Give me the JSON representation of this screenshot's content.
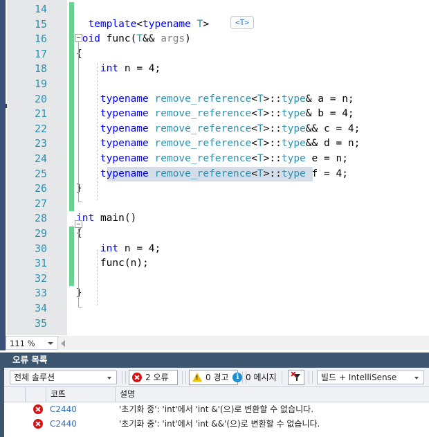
{
  "editor": {
    "zoom_level": "111 %",
    "first_line": 14,
    "lines": [
      {
        "n": 14,
        "html": "",
        "changed": true
      },
      {
        "n": 15,
        "html": "  <span class='kw'>template</span><span class='punc'>&lt;</span><span class='kw'>typename</span> <span class='typ'>T</span><span class='punc'>&gt;</span>",
        "changed": true
      },
      {
        "n": 16,
        "html": "<span class='kw'>void</span> <span class='ident'>func</span><span class='punc'>(</span><span class='typ'>T</span><span class='punc'>&amp;&amp;</span> <span class='gray'>args</span><span class='punc'>)</span>",
        "changed": true
      },
      {
        "n": 17,
        "html": "<span class='punc'>{</span>",
        "changed": true
      },
      {
        "n": 18,
        "html": "    <span class='kw'>int</span> <span class='ident'>n</span> = <span class='ident'>4</span>;",
        "changed": true
      },
      {
        "n": 19,
        "html": "",
        "changed": true
      },
      {
        "n": 20,
        "html": "    <span class='kw'>typename</span> <span class='typ'>remove_reference</span><span class='punc'>&lt;</span><span class='typ'>T</span><span class='punc'>&gt;::</span><span class='typ'>type</span><span class='punc'>&amp;</span> <span class='ident'>a</span> = <span class='ident'>n</span>;",
        "changed": true
      },
      {
        "n": 21,
        "html": "    <span class='kw'>typename</span> <span class='typ'>remove_reference</span><span class='punc'>&lt;</span><span class='typ'>T</span><span class='punc'>&gt;::</span><span class='typ'>type</span><span class='punc'>&amp;</span> <span class='ident'>b</span> = <span class='ident'>4</span>;",
        "changed": true
      },
      {
        "n": 22,
        "html": "    <span class='kw'>typename</span> <span class='typ'>remove_reference</span><span class='punc'>&lt;</span><span class='typ'>T</span><span class='punc'>&gt;::</span><span class='typ'>type</span><span class='punc'>&amp;&amp;</span> <span class='ident'>c</span> = <span class='ident'>4</span>;",
        "changed": true
      },
      {
        "n": 23,
        "html": "    <span class='kw'>typename</span> <span class='typ'>remove_reference</span><span class='punc'>&lt;</span><span class='typ'>T</span><span class='punc'>&gt;::</span><span class='typ'>type</span><span class='punc'>&amp;&amp;</span> <span class='ident'>d</span> = <span class='ident'>n</span>;",
        "changed": true
      },
      {
        "n": 24,
        "html": "    <span class='kw'>typename</span> <span class='typ'>remove_reference</span><span class='punc'>&lt;</span><span class='typ'>T</span><span class='punc'>&gt;::</span><span class='typ'>type</span> <span class='ident'>e</span> = <span class='ident'>n</span>;",
        "changed": true
      },
      {
        "n": 25,
        "html": "    <span class='kw'>typename</span> <span class='typ'>remove_reference</span><span class='punc'>&lt;</span><span class='typ'>T</span><span class='punc'>&gt;::</span><span class='typ'>type</span> <span class='ident'>f</span> = <span class='ident'>4</span>;",
        "changed": true
      },
      {
        "n": 26,
        "html": "<span class='punc'>}</span>",
        "changed": true
      },
      {
        "n": 27,
        "html": "",
        "changed": true
      },
      {
        "n": 28,
        "html": "<span class='kw'>int</span> <span class='ident'>main</span><span class='punc'>()</span>",
        "changed": false
      },
      {
        "n": 29,
        "html": "<span class='punc'>{</span>",
        "changed": true
      },
      {
        "n": 30,
        "html": "    <span class='kw'>int</span> <span class='ident'>n</span> = <span class='ident'>4</span>;",
        "changed": true
      },
      {
        "n": 31,
        "html": "    <span class='ident'>func</span><span class='punc'>(</span><span class='ident'>n</span><span class='punc'>)</span>;",
        "changed": true
      },
      {
        "n": 32,
        "html": "",
        "changed": true
      },
      {
        "n": 33,
        "html": "<span class='punc'>}</span>",
        "changed": false
      },
      {
        "n": 34,
        "html": "",
        "changed": false
      },
      {
        "n": 35,
        "html": "",
        "changed": false
      }
    ],
    "template_badge": "<T>",
    "selected_line": 25
  },
  "error_list": {
    "title": "오류 목록",
    "scope_filter": "전체 솔루션",
    "errors_toggle": "2 오류",
    "warnings_toggle": "0 경고",
    "messages_toggle": "0 메시지",
    "build_filter": "빌드 + IntelliSense",
    "columns": [
      "코드",
      "설명"
    ],
    "rows": [
      {
        "severity": "error",
        "code": "C2440",
        "description": "'초기화 중': 'int'에서 'int &'(으)로 변환할 수 없습니다."
      },
      {
        "severity": "error",
        "code": "C2440",
        "description": "'초기화 중': 'int'에서 'int &&'(으)로 변환할 수 없습니다."
      }
    ]
  },
  "colors": {
    "keyword": "#0000ff",
    "type": "#2b91af",
    "linenumber": "#2b91af",
    "change_bar": "#68d391",
    "panel_chrome": "#3d556f",
    "error_red": "#d51317",
    "warning_yellow": "#f2c200",
    "info_blue": "#1a8fd1",
    "link_blue": "#2b6fbd"
  }
}
